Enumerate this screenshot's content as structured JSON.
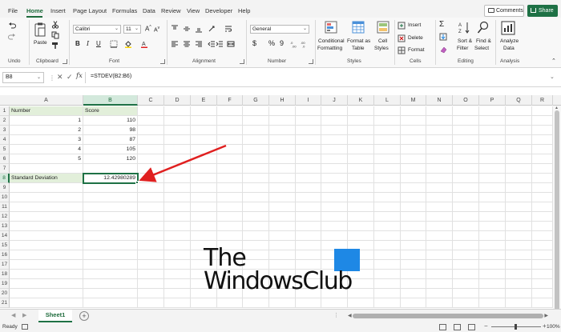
{
  "menu": {
    "tabs": [
      "File",
      "Home",
      "Insert",
      "Page Layout",
      "Formulas",
      "Data",
      "Review",
      "View",
      "Developer",
      "Help"
    ],
    "active": "Home",
    "comments": "Comments",
    "share": "Share"
  },
  "ribbon": {
    "groups": {
      "undo": "Undo",
      "clipboard": "Clipboard",
      "font": "Font",
      "alignment": "Alignment",
      "number": "Number",
      "styles": "Styles",
      "cells": "Cells",
      "editing": "Editing",
      "analysis": "Analysis"
    },
    "paste": "Paste",
    "font_name": "Calibri",
    "font_size": "11",
    "number_format": "General",
    "conditional_formatting": [
      "Conditional",
      "Formatting"
    ],
    "format_as_table": [
      "Format as",
      "Table"
    ],
    "cell_styles": [
      "Cell",
      "Styles"
    ],
    "insert": "Insert",
    "delete": "Delete",
    "format": "Format",
    "sort_filter": [
      "Sort &",
      "Filter"
    ],
    "find_select": [
      "Find &",
      "Select"
    ],
    "analyze_data": [
      "Analyze",
      "Data"
    ],
    "bold": "B",
    "italic": "I",
    "underline": "U",
    "currency": "$",
    "percent": "%",
    "comma": "9"
  },
  "formula_bar": {
    "name_box": "B8",
    "fx": "fx",
    "formula": "=STDEV(B2:B6)"
  },
  "columns": [
    "A",
    "B",
    "C",
    "D",
    "E",
    "F",
    "G",
    "H",
    "I",
    "J",
    "K",
    "L",
    "M",
    "N",
    "O",
    "P",
    "Q",
    "R"
  ],
  "selected_column": "B",
  "selected_row": 8,
  "rows": [
    {
      "n": "1",
      "a": "Number",
      "b": "Score"
    },
    {
      "n": "2",
      "a": "",
      "b": "",
      "a_num": "1",
      "b_num": "110"
    },
    {
      "n": "3",
      "a": "",
      "b": "",
      "a_num": "2",
      "b_num": "98"
    },
    {
      "n": "4",
      "a": "",
      "b": "",
      "a_num": "3",
      "b_num": "87"
    },
    {
      "n": "5",
      "a": "",
      "b": "",
      "a_num": "4",
      "b_num": "105"
    },
    {
      "n": "6",
      "a": "",
      "b": "",
      "a_num": "5",
      "b_num": "120"
    },
    {
      "n": "7"
    },
    {
      "n": "8",
      "a": "Standard Deviation",
      "b_num": "12.42980289"
    },
    {
      "n": "9"
    },
    {
      "n": "10"
    },
    {
      "n": "11"
    },
    {
      "n": "12"
    },
    {
      "n": "13"
    },
    {
      "n": "14"
    },
    {
      "n": "15"
    },
    {
      "n": "16"
    },
    {
      "n": "17"
    },
    {
      "n": "18"
    },
    {
      "n": "19"
    },
    {
      "n": "20"
    },
    {
      "n": "21"
    }
  ],
  "sheet": {
    "tabs": [
      "Sheet1"
    ],
    "active": "Sheet1"
  },
  "status": {
    "ready": "Ready",
    "zoom": "100%"
  },
  "watermark": {
    "line1": "The",
    "line2": "WindowsClub"
  },
  "colors": {
    "accent": "#1e7145",
    "header_fill": "#e2efda",
    "arrow": "#e02020"
  }
}
